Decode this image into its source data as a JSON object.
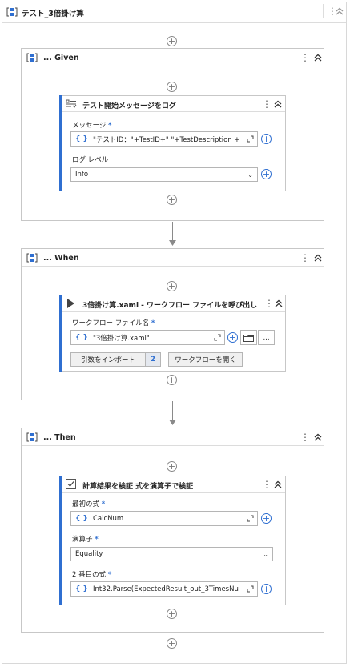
{
  "root": {
    "title": "テスト_3倍掛け算"
  },
  "given": {
    "title": "... Given",
    "activity": {
      "title": "テスト開始メッセージをログ",
      "message_label": "メッセージ",
      "message_value": "\"テストID：\"+TestID+\" \"+TestDescription +",
      "level_label": "ログ レベル",
      "level_value": "Info"
    }
  },
  "when": {
    "title": "... When",
    "activity": {
      "title": "3倍掛け算.xaml - ワークフロー ファイルを呼び出し",
      "file_label": "ワークフロー ファイル名",
      "file_value": "\"3倍掛け算.xaml\"",
      "browse_label": "...",
      "import_args_label": "引数をインポート",
      "import_args_count": "2",
      "open_workflow_label": "ワークフローを開く"
    }
  },
  "then": {
    "title": "... Then",
    "activity": {
      "title": "計算結果を検証 式を演算子で検証",
      "first_label": "最初の式",
      "first_value": "CalcNum",
      "operator_label": "演算子",
      "operator_value": "Equality",
      "second_label": "2 番目の式",
      "second_value": "Int32.Parse(ExpectedResult_out_3TimesNu"
    }
  },
  "common": {
    "required_mark": "*",
    "brace": "{ }",
    "plus": "+",
    "dots": "⋮"
  },
  "colors": {
    "accent": "#2f6fd1",
    "border": "#c7c7c7"
  }
}
